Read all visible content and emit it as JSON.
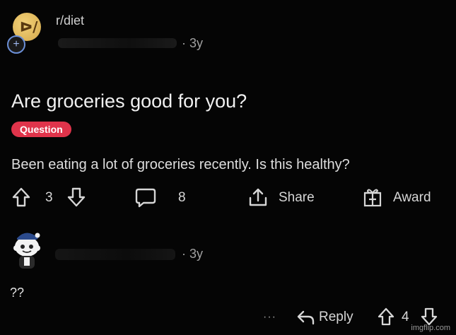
{
  "post": {
    "subreddit": "r/diet",
    "age": "· 3y",
    "title": "Are groceries good for you?",
    "flair": "Question",
    "flair_color": "#e0344b",
    "body": "Been eating a lot of groceries recently. Is this healthy?",
    "vote_count": "3",
    "comment_count": "8",
    "share_label": "Share",
    "award_label": "Award",
    "join_icon": "plus-icon"
  },
  "comment": {
    "age": "· 3y",
    "body": "??",
    "more_label": "···",
    "reply_label": "Reply",
    "vote_count": "4"
  },
  "watermark": "imgflip.com"
}
